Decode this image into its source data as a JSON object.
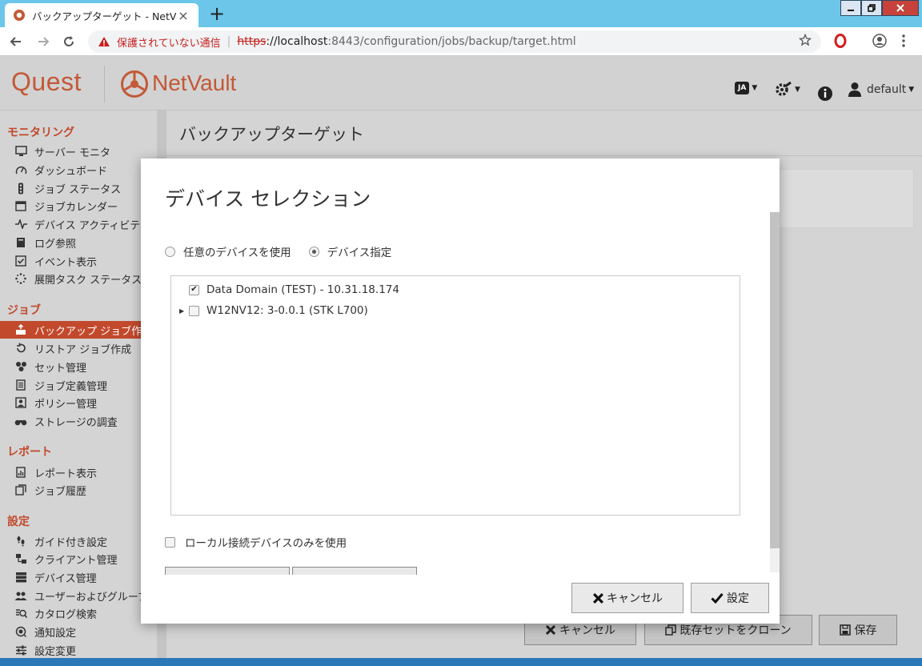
{
  "browser": {
    "tab_title": "バックアップターゲット - NetVault",
    "tab_close": "×",
    "new_tab": "+",
    "address": {
      "security_label": "保護されていない通信",
      "scheme": "https",
      "host": "://localhost",
      "path": ":8443/configuration/jobs/backup/target.html"
    }
  },
  "header": {
    "brand": "Quest",
    "product": "NetVault",
    "language_badge": "JA",
    "user": "default"
  },
  "sidebar": {
    "sections": [
      {
        "title": "モニタリング",
        "items": [
          {
            "label": "サーバー モニタ",
            "icon": "monitor-icon"
          },
          {
            "label": "ダッシュボード",
            "icon": "dashboard-icon"
          },
          {
            "label": "ジョブ ステータス",
            "icon": "traffic-light-icon"
          },
          {
            "label": "ジョブカレンダー",
            "icon": "calendar-icon"
          },
          {
            "label": "デバイス アクティビティ",
            "icon": "activity-icon"
          },
          {
            "label": "ログ参照",
            "icon": "log-book-icon"
          },
          {
            "label": "イベント表示",
            "icon": "event-check-icon"
          },
          {
            "label": "展開タスク ステータス",
            "icon": "spinner-icon"
          }
        ]
      },
      {
        "title": "ジョブ",
        "items": [
          {
            "label": "バックアップ ジョブ作成",
            "icon": "backup-icon",
            "active": true
          },
          {
            "label": "リストア ジョブ作成",
            "icon": "restore-icon"
          },
          {
            "label": "セット管理",
            "icon": "sets-icon"
          },
          {
            "label": "ジョブ定義管理",
            "icon": "job-definition-icon"
          },
          {
            "label": "ポリシー管理",
            "icon": "policy-icon"
          },
          {
            "label": "ストレージの調査",
            "icon": "binoculars-icon"
          }
        ]
      },
      {
        "title": "レポート",
        "items": [
          {
            "label": "レポート表示",
            "icon": "report-icon"
          },
          {
            "label": "ジョブ履歴",
            "icon": "history-icon"
          }
        ]
      },
      {
        "title": "設定",
        "items": [
          {
            "label": "ガイド付き設定",
            "icon": "footsteps-icon"
          },
          {
            "label": "クライアント管理",
            "icon": "clients-icon"
          },
          {
            "label": "デバイス管理",
            "icon": "devices-icon"
          },
          {
            "label": "ユーザーおよびグループ",
            "icon": "users-icon"
          },
          {
            "label": "カタログ検索",
            "icon": "catalog-search-icon"
          },
          {
            "label": "通知設定",
            "icon": "notification-icon"
          },
          {
            "label": "設定変更",
            "icon": "sliders-icon"
          }
        ]
      }
    ]
  },
  "main": {
    "title": "バックアップターゲット",
    "buttons": {
      "cancel": "キャンセル",
      "clone": "既存セットをクローン",
      "save": "保存"
    }
  },
  "modal": {
    "title": "デバイス セレクション",
    "radios": [
      {
        "label": "任意のデバイスを使用",
        "checked": false
      },
      {
        "label": "デバイス指定",
        "checked": true
      }
    ],
    "devices": [
      {
        "label": "Data Domain (TEST) - 10.31.18.174",
        "checked": true,
        "expandable": false
      },
      {
        "label": "W12NV12: 3-0.0.1 (STK L700)",
        "checked": false,
        "expandable": true
      }
    ],
    "local_only_label": "ローカル接続デバイスのみを使用",
    "local_only_checked": false,
    "cancel_label": "キャンセル",
    "ok_label": "設定"
  },
  "colors": {
    "accent": "#c2492b",
    "brand": "#c25937",
    "tabbar": "#6bc6ea"
  }
}
